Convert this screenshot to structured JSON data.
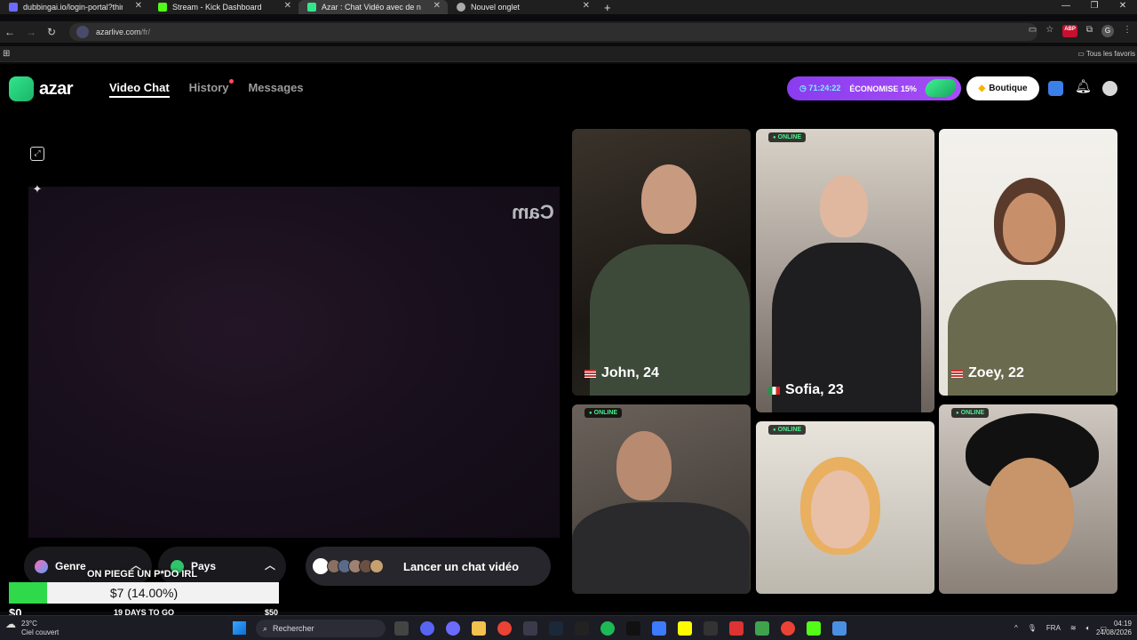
{
  "browser": {
    "tabs": [
      {
        "label": "dubbingai.io/login-portal?third",
        "active": false,
        "favicon_color": "#6b6bff"
      },
      {
        "label": "Stream - Kick Dashboard",
        "active": false,
        "favicon_color": "#53fc18"
      },
      {
        "label": "Azar : Chat Vidéo avec de n",
        "active": true,
        "favicon_color": "#32e58a"
      },
      {
        "label": "Nouvel onglet",
        "active": false,
        "favicon_color": "#aaaaaa"
      }
    ],
    "url_domain": "azarlive.com",
    "url_path": "/fr/",
    "bookmarks_all": "Tous les favoris"
  },
  "header": {
    "logo_text": "azar",
    "nav": [
      {
        "label": "Video Chat",
        "active": true,
        "dot": false
      },
      {
        "label": "History",
        "active": false,
        "dot": true
      },
      {
        "label": "Messages",
        "active": false,
        "dot": false
      }
    ],
    "promo_time": "71:24:22",
    "promo_text": "ÉCONOMISE 15%",
    "shop_label": "Boutique"
  },
  "video": {
    "mirrored_text": "Cam",
    "gender_label": "Genre",
    "country_label": "Pays",
    "start_label": "Lancer un chat vidéo"
  },
  "profiles": [
    {
      "name": "John, 24",
      "online": false,
      "online_label": "",
      "flag": "us"
    },
    {
      "name": "Sofia, 23",
      "online": true,
      "online_label": "ONLINE",
      "flag": "it"
    },
    {
      "name": "Zoey, 22",
      "online": false,
      "online_label": "",
      "flag": "us"
    },
    {
      "name": "",
      "online": true,
      "online_label": "ONLINE",
      "flag": ""
    },
    {
      "name": "",
      "online": true,
      "online_label": "ONLINE",
      "flag": ""
    },
    {
      "name": "",
      "online": true,
      "online_label": "ONLINE",
      "flag": ""
    }
  ],
  "overlay": {
    "title": "ON PIEGE UN P*DO IRL",
    "amount": "$7 (14.00%)",
    "progress_fraction": 0.14,
    "min": "$0",
    "days": "19 DAYS TO GO",
    "max": "$50"
  },
  "taskbar": {
    "temp": "23°C",
    "weather": "Ciel couvert",
    "search_placeholder": "Rechercher",
    "lang": "FRA",
    "time": "04:19",
    "date": "24/08/2026"
  }
}
